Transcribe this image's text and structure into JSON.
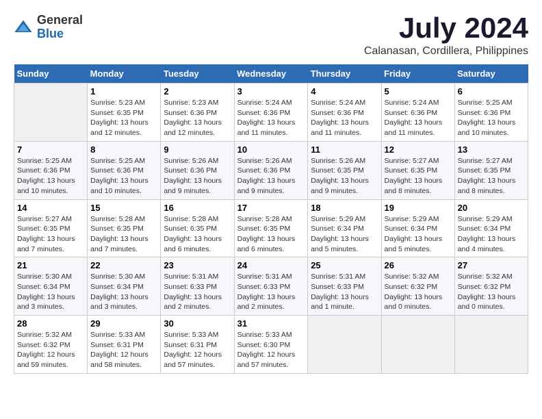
{
  "header": {
    "logo_general": "General",
    "logo_blue": "Blue",
    "month": "July 2024",
    "location": "Calanasan, Cordillera, Philippines"
  },
  "calendar": {
    "days_of_week": [
      "Sunday",
      "Monday",
      "Tuesday",
      "Wednesday",
      "Thursday",
      "Friday",
      "Saturday"
    ],
    "weeks": [
      [
        {
          "day": "",
          "content": ""
        },
        {
          "day": "1",
          "content": "Sunrise: 5:23 AM\nSunset: 6:35 PM\nDaylight: 13 hours\nand 12 minutes."
        },
        {
          "day": "2",
          "content": "Sunrise: 5:23 AM\nSunset: 6:36 PM\nDaylight: 13 hours\nand 12 minutes."
        },
        {
          "day": "3",
          "content": "Sunrise: 5:24 AM\nSunset: 6:36 PM\nDaylight: 13 hours\nand 11 minutes."
        },
        {
          "day": "4",
          "content": "Sunrise: 5:24 AM\nSunset: 6:36 PM\nDaylight: 13 hours\nand 11 minutes."
        },
        {
          "day": "5",
          "content": "Sunrise: 5:24 AM\nSunset: 6:36 PM\nDaylight: 13 hours\nand 11 minutes."
        },
        {
          "day": "6",
          "content": "Sunrise: 5:25 AM\nSunset: 6:36 PM\nDaylight: 13 hours\nand 10 minutes."
        }
      ],
      [
        {
          "day": "7",
          "content": "Sunrise: 5:25 AM\nSunset: 6:36 PM\nDaylight: 13 hours\nand 10 minutes."
        },
        {
          "day": "8",
          "content": "Sunrise: 5:25 AM\nSunset: 6:36 PM\nDaylight: 13 hours\nand 10 minutes."
        },
        {
          "day": "9",
          "content": "Sunrise: 5:26 AM\nSunset: 6:36 PM\nDaylight: 13 hours\nand 9 minutes."
        },
        {
          "day": "10",
          "content": "Sunrise: 5:26 AM\nSunset: 6:36 PM\nDaylight: 13 hours\nand 9 minutes."
        },
        {
          "day": "11",
          "content": "Sunrise: 5:26 AM\nSunset: 6:35 PM\nDaylight: 13 hours\nand 9 minutes."
        },
        {
          "day": "12",
          "content": "Sunrise: 5:27 AM\nSunset: 6:35 PM\nDaylight: 13 hours\nand 8 minutes."
        },
        {
          "day": "13",
          "content": "Sunrise: 5:27 AM\nSunset: 6:35 PM\nDaylight: 13 hours\nand 8 minutes."
        }
      ],
      [
        {
          "day": "14",
          "content": "Sunrise: 5:27 AM\nSunset: 6:35 PM\nDaylight: 13 hours\nand 7 minutes."
        },
        {
          "day": "15",
          "content": "Sunrise: 5:28 AM\nSunset: 6:35 PM\nDaylight: 13 hours\nand 7 minutes."
        },
        {
          "day": "16",
          "content": "Sunrise: 5:28 AM\nSunset: 6:35 PM\nDaylight: 13 hours\nand 6 minutes."
        },
        {
          "day": "17",
          "content": "Sunrise: 5:28 AM\nSunset: 6:35 PM\nDaylight: 13 hours\nand 6 minutes."
        },
        {
          "day": "18",
          "content": "Sunrise: 5:29 AM\nSunset: 6:34 PM\nDaylight: 13 hours\nand 5 minutes."
        },
        {
          "day": "19",
          "content": "Sunrise: 5:29 AM\nSunset: 6:34 PM\nDaylight: 13 hours\nand 5 minutes."
        },
        {
          "day": "20",
          "content": "Sunrise: 5:29 AM\nSunset: 6:34 PM\nDaylight: 13 hours\nand 4 minutes."
        }
      ],
      [
        {
          "day": "21",
          "content": "Sunrise: 5:30 AM\nSunset: 6:34 PM\nDaylight: 13 hours\nand 3 minutes."
        },
        {
          "day": "22",
          "content": "Sunrise: 5:30 AM\nSunset: 6:34 PM\nDaylight: 13 hours\nand 3 minutes."
        },
        {
          "day": "23",
          "content": "Sunrise: 5:31 AM\nSunset: 6:33 PM\nDaylight: 13 hours\nand 2 minutes."
        },
        {
          "day": "24",
          "content": "Sunrise: 5:31 AM\nSunset: 6:33 PM\nDaylight: 13 hours\nand 2 minutes."
        },
        {
          "day": "25",
          "content": "Sunrise: 5:31 AM\nSunset: 6:33 PM\nDaylight: 13 hours\nand 1 minute."
        },
        {
          "day": "26",
          "content": "Sunrise: 5:32 AM\nSunset: 6:32 PM\nDaylight: 13 hours\nand 0 minutes."
        },
        {
          "day": "27",
          "content": "Sunrise: 5:32 AM\nSunset: 6:32 PM\nDaylight: 13 hours\nand 0 minutes."
        }
      ],
      [
        {
          "day": "28",
          "content": "Sunrise: 5:32 AM\nSunset: 6:32 PM\nDaylight: 12 hours\nand 59 minutes."
        },
        {
          "day": "29",
          "content": "Sunrise: 5:33 AM\nSunset: 6:31 PM\nDaylight: 12 hours\nand 58 minutes."
        },
        {
          "day": "30",
          "content": "Sunrise: 5:33 AM\nSunset: 6:31 PM\nDaylight: 12 hours\nand 57 minutes."
        },
        {
          "day": "31",
          "content": "Sunrise: 5:33 AM\nSunset: 6:30 PM\nDaylight: 12 hours\nand 57 minutes."
        },
        {
          "day": "",
          "content": ""
        },
        {
          "day": "",
          "content": ""
        },
        {
          "day": "",
          "content": ""
        }
      ]
    ]
  }
}
